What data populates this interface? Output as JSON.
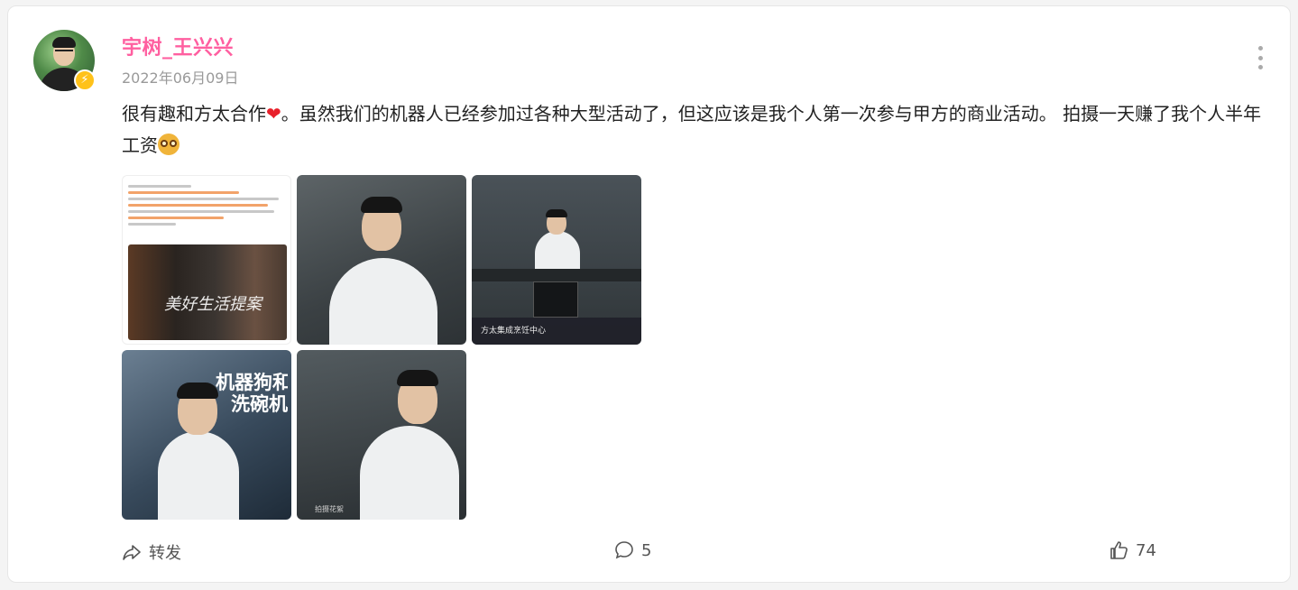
{
  "post": {
    "author": "宇树_王兴兴",
    "date": "2022年06月09日",
    "text_part1": "很有趣和方太合作",
    "heart": "❤",
    "text_part2": "。虽然我们的机器人已经参加过各种大型活动了，但这应该是我个人第一次参与甲方的商业活动。 拍摄一天赚了我个人半年工资",
    "badge_icon": "lightning-icon"
  },
  "images": {
    "tile1_caption": "美好生活提案",
    "tile3_caption": "方太集成烹饪中心",
    "tile4_caption": "机器狗和\n洗碗机",
    "tile5_tag": "拍摄花絮"
  },
  "actions": {
    "share_label": "转发",
    "comment_count": "5",
    "like_count": "74"
  },
  "colors": {
    "author": "#ff5fa0",
    "badge": "#ffc21a"
  }
}
